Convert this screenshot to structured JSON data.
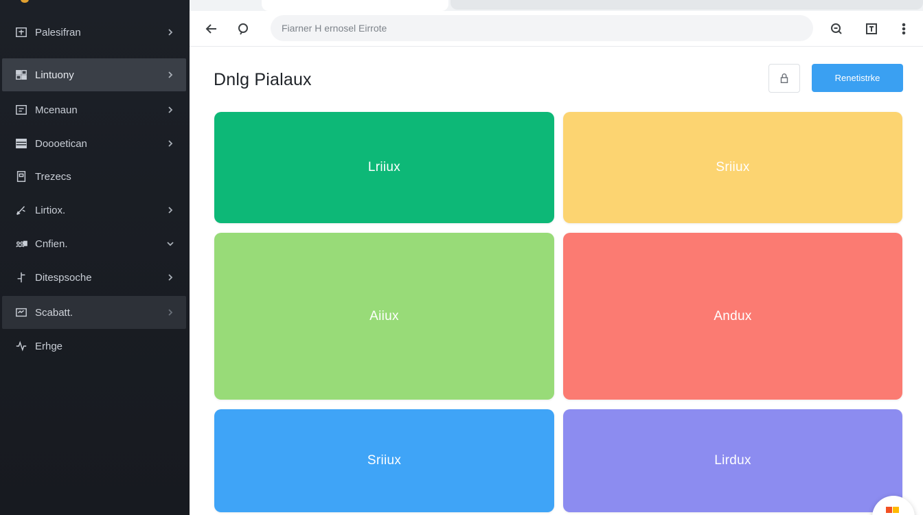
{
  "sidebar": {
    "items": [
      {
        "label": "Palesifran",
        "icon": "image-frame-icon",
        "chevron": "right"
      },
      {
        "label": "Lintuony",
        "icon": "grid-flag-icon",
        "chevron": "right"
      },
      {
        "label": "Mcenaun",
        "icon": "panel-icon",
        "chevron": "right"
      },
      {
        "label": "Doooetican",
        "icon": "list-icon",
        "chevron": "right"
      },
      {
        "label": "Trezecs",
        "icon": "document-icon",
        "chevron": ""
      },
      {
        "label": "Lirtiox.",
        "icon": "pen-icon",
        "chevron": "right"
      },
      {
        "label": "Cnfien.",
        "icon": "users-icon",
        "chevron": "down"
      },
      {
        "label": "Ditespsoche",
        "icon": "branch-icon",
        "chevron": "right"
      },
      {
        "label": "Scabatt.",
        "icon": "screen-icon",
        "chevron": "right"
      },
      {
        "label": "Erhge",
        "icon": "pulse-icon",
        "chevron": ""
      }
    ]
  },
  "toolbar": {
    "url_placeholder": "Fiarner H ernosel Eirrote"
  },
  "main": {
    "title": "Dnlg Pialaux",
    "primary_button": "Renetistrke"
  },
  "cards": [
    {
      "label": "Lriiux",
      "color": "#0db877"
    },
    {
      "label": "Sriiux",
      "color": "#fcd471"
    },
    {
      "label": "Aiiux",
      "color": "#98db78"
    },
    {
      "label": "Andux",
      "color": "#fb7b72"
    },
    {
      "label": "Sriiux",
      "color": "#3fa4f7"
    },
    {
      "label": "Lirdux",
      "color": "#8c8cf0"
    }
  ],
  "colors": {
    "sidebar_bg": "#1c2027",
    "accent": "#3aa0f2"
  }
}
